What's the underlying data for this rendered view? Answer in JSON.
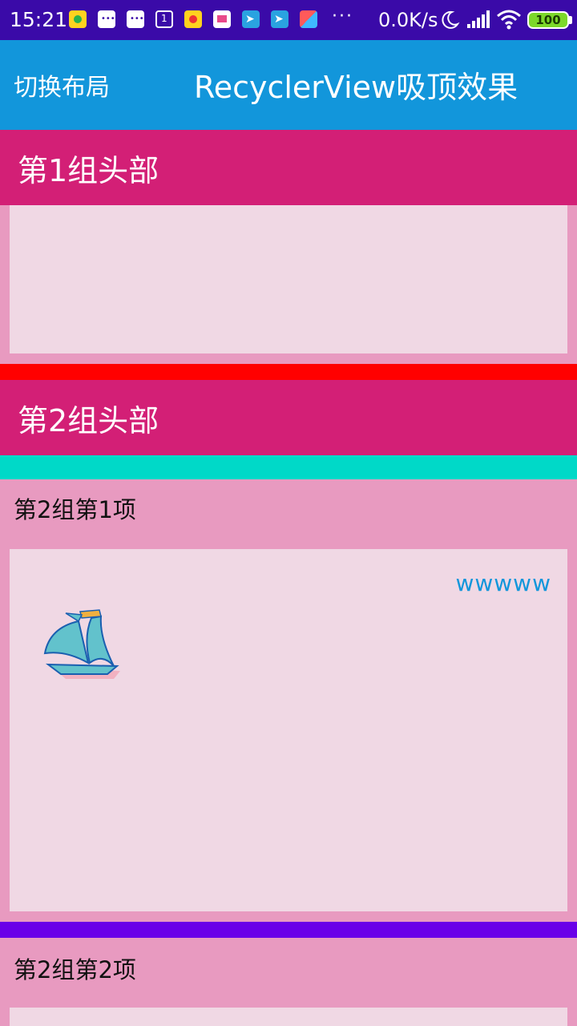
{
  "status_bar": {
    "time": "15:21",
    "dots": "···",
    "net_speed": "0.0K/s",
    "battery": "100",
    "notification_icons": [
      "baidu-icon",
      "message-icon",
      "message-icon",
      "calendar-icon",
      "baidu-icon",
      "mail-icon",
      "telegram-icon",
      "telegram-icon",
      "kite-icon"
    ],
    "colors": {
      "background": "#3a0aa8",
      "battery": "#7cd82a"
    }
  },
  "app_bar": {
    "switch_label": "切换布局",
    "title": "RecyclerView吸顶效果",
    "color": "#1296db"
  },
  "groups": [
    {
      "header": "第1组头部"
    },
    {
      "header": "第2组头部",
      "items": [
        "第2组第1项",
        "第2组第2项"
      ]
    }
  ],
  "card": {
    "text": "wwwww",
    "image": "sailboat-icon"
  },
  "colors": {
    "header": "#d31f76",
    "item_background": "#e89ac0",
    "panel": "#f0d8e4",
    "divider_red": "#ff0000",
    "divider_cyan": "#00d9c8",
    "divider_purple": "#6a00e8"
  }
}
